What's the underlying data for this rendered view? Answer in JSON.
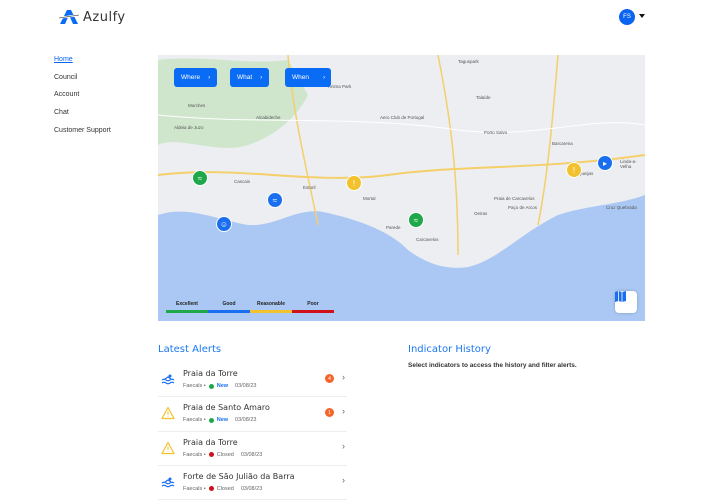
{
  "header": {
    "logo_text": "Azulfy",
    "avatar_initials": "FS"
  },
  "nav": [
    {
      "label": "Home"
    },
    {
      "label": "Council"
    },
    {
      "label": "Account"
    },
    {
      "label": "Chat"
    },
    {
      "label": "Customer Support"
    }
  ],
  "map": {
    "filters": [
      {
        "label": "Where"
      },
      {
        "label": "What"
      },
      {
        "label": "When"
      }
    ],
    "places": [
      "Alcabideche",
      "Aldeia de Juzo",
      "Estoril",
      "Mortal",
      "Parede",
      "Carcavelos",
      "Oeiras",
      "Porto Salvo",
      "Barcarena",
      "Talaíde",
      "Cascais",
      "Murches",
      "Taguspark",
      "Queijas",
      "Cruz Quebrada",
      "Linda-a-Velha",
      "Paço de Arcos",
      "Praia de Carcavelos",
      "Aero Club de Portugal",
      "Anima Park"
    ],
    "legend": [
      {
        "label": "Excellent",
        "color": "#1fa84a"
      },
      {
        "label": "Good",
        "color": "#1a6ff0"
      },
      {
        "label": "Reasonable",
        "color": "#f2c12e"
      },
      {
        "label": "Poor",
        "color": "#d0101a"
      }
    ]
  },
  "latest_alerts": {
    "title": "Latest Alerts",
    "items": [
      {
        "icon": "swim",
        "title": "Praia da Torre",
        "indicator": "Faecals •",
        "status": "New",
        "status_color": "#1fa84a",
        "date": "03/08/23",
        "badge": "4"
      },
      {
        "icon": "warning",
        "title": "Praia de Santo Amaro",
        "indicator": "Faecals •",
        "status": "New",
        "status_color": "#1fa84a",
        "date": "03/08/23",
        "badge": "1"
      },
      {
        "icon": "warning",
        "title": "Praia da Torre",
        "indicator": "Faecals •",
        "status": "Closed",
        "status_color": "#d0101a",
        "date": "03/08/23",
        "badge": null
      },
      {
        "icon": "swim",
        "title": "Forte de São Julião da Barra",
        "indicator": "Faecals •",
        "status": "Closed",
        "status_color": "#d0101a",
        "date": "03/08/23",
        "badge": null
      }
    ]
  },
  "indicator_history": {
    "title": "Indicator History",
    "text": "Select indicators to access the history and filter alerts."
  }
}
